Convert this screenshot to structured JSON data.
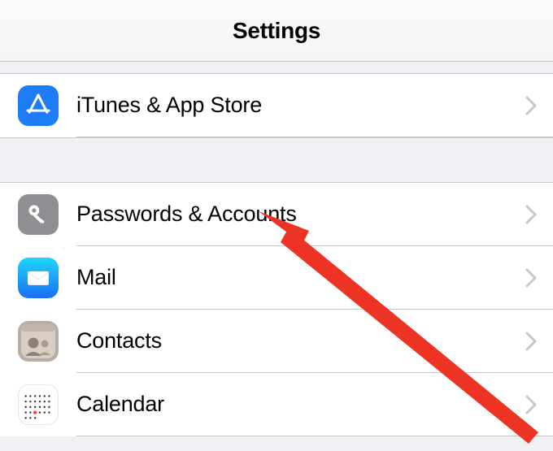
{
  "header": {
    "title": "Settings"
  },
  "section1": {
    "items": [
      {
        "label": "iTunes & App Store",
        "icon": "appstore-icon",
        "bg": "#1e7cf7"
      }
    ]
  },
  "section2": {
    "items": [
      {
        "label": "Passwords & Accounts",
        "icon": "key-icon",
        "bg": "#8e8e93"
      },
      {
        "label": "Mail",
        "icon": "mail-icon",
        "bg": "#1c9cf6"
      },
      {
        "label": "Contacts",
        "icon": "contacts-icon",
        "bg": "#b9ada3"
      },
      {
        "label": "Calendar",
        "icon": "calendar-icon",
        "bg": "#ffffff"
      }
    ]
  },
  "annotation": {
    "arrow_color": "#ed3424"
  }
}
